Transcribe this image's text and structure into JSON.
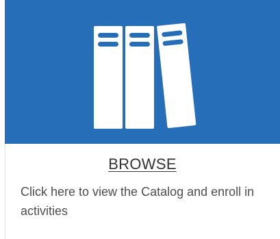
{
  "card": {
    "title": "BROWSE",
    "description": "Click here to view the Catalog and enroll in activities",
    "icon": "books-icon",
    "banner_color": "#266eb7",
    "icon_color": "#ffffff"
  }
}
